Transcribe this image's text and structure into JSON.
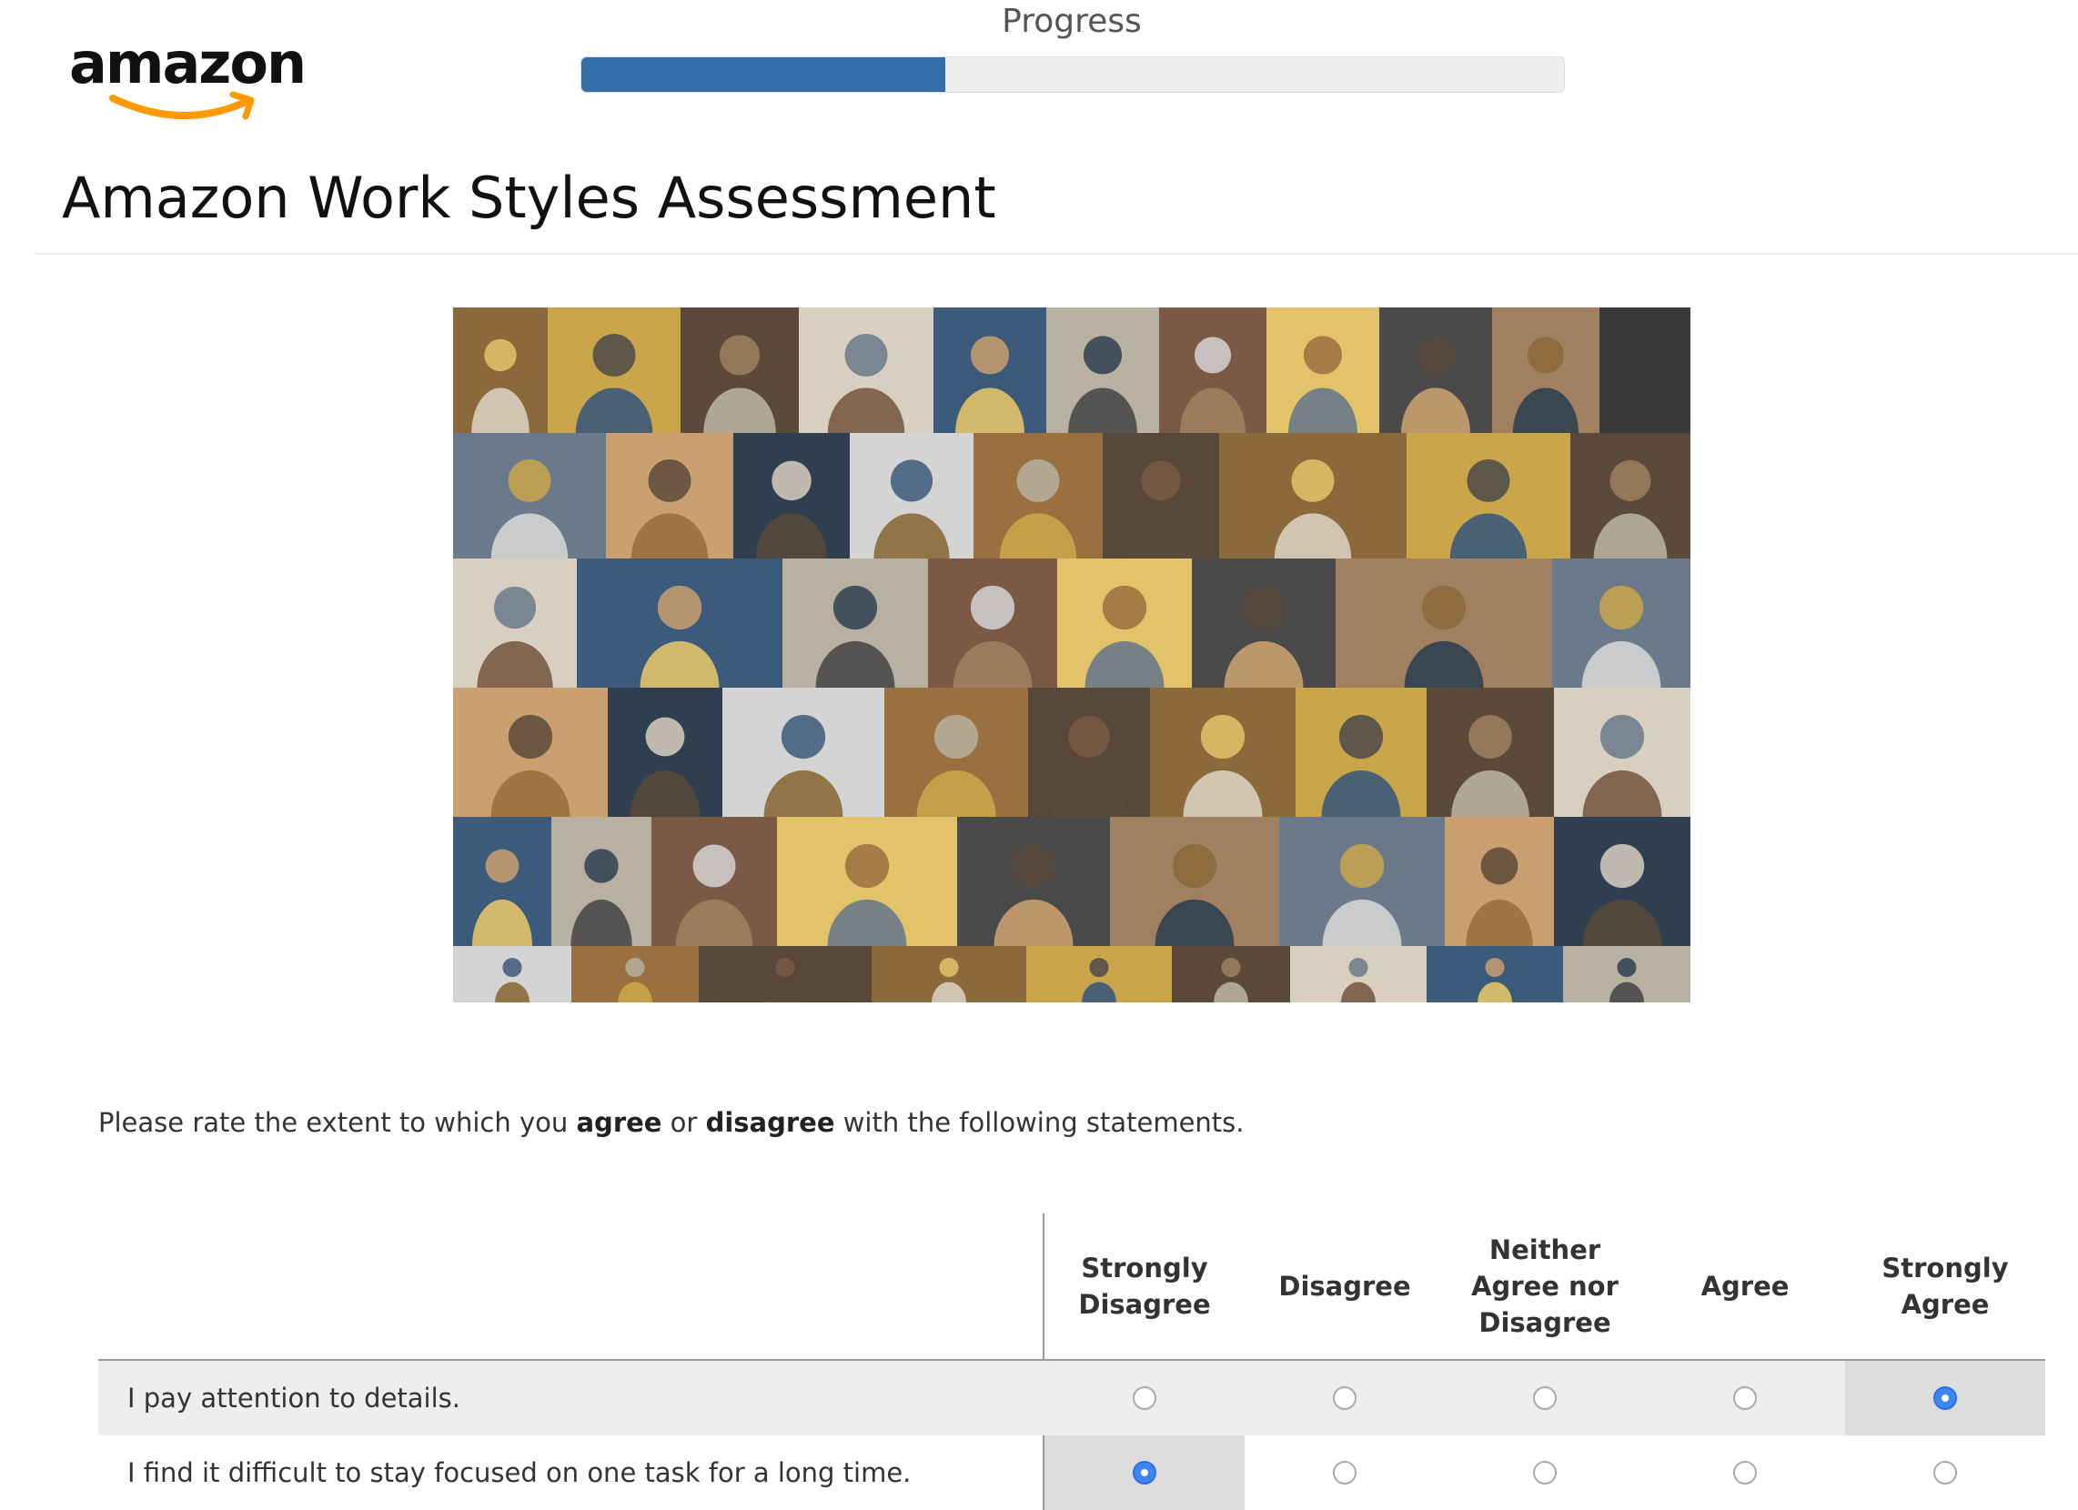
{
  "brand": {
    "logo_text": "amazon",
    "accent_color": "#ff9900"
  },
  "progress": {
    "label": "Progress",
    "fraction": 0.37,
    "fill_color": "#336ea8"
  },
  "page": {
    "title": "Amazon Work Styles Assessment"
  },
  "instructions": {
    "prefix": "Please rate the extent to which you ",
    "agree": "agree",
    "middle": " or ",
    "disagree": "disagree",
    "suffix": " with the following statements."
  },
  "survey": {
    "columns": [
      "Strongly Disagree",
      "Disagree",
      "Neither Agree nor Disagree",
      "Agree",
      "Strongly Agree"
    ],
    "statements": [
      {
        "text": "I pay attention to details.",
        "selected": 4
      },
      {
        "text": "I find it difficult to stay focused on one task for a long time.",
        "selected": 0
      }
    ]
  }
}
